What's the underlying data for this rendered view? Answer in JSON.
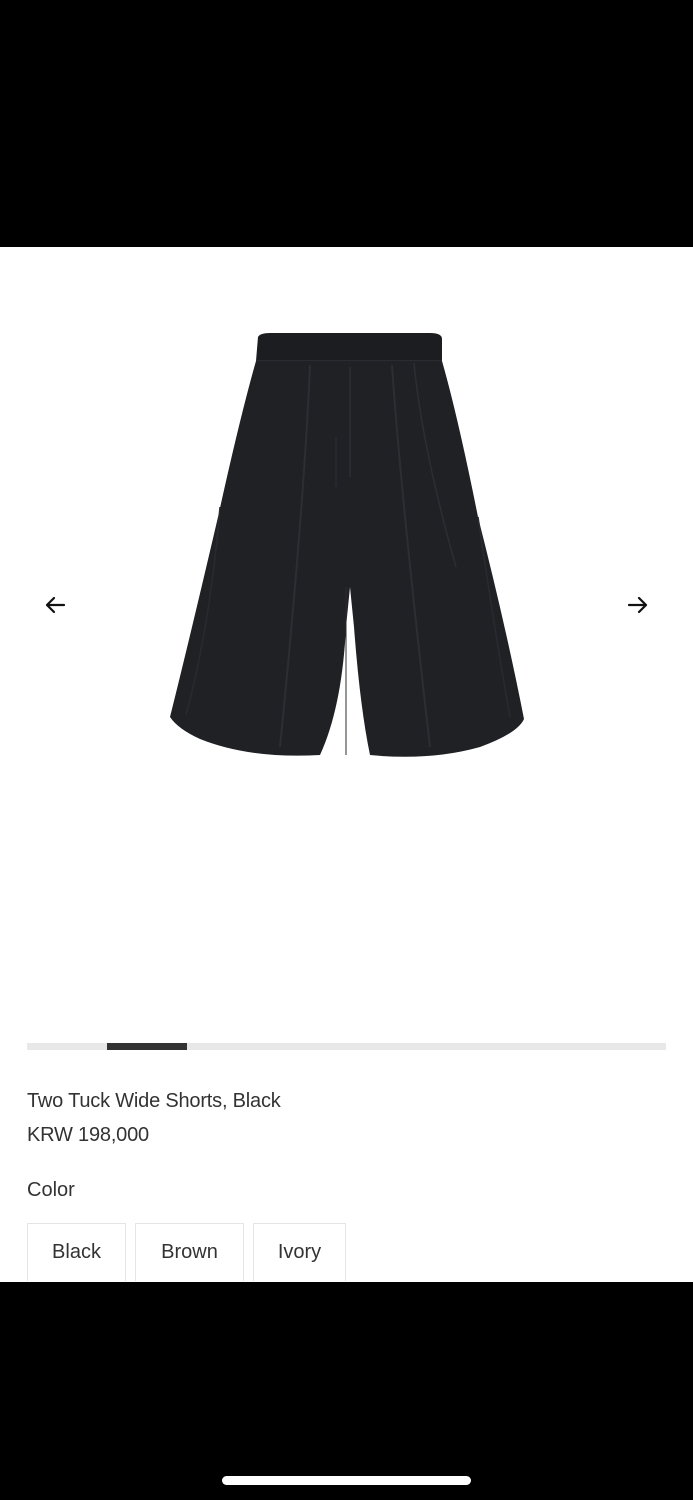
{
  "product": {
    "name": "Two Tuck Wide Shorts, Black",
    "price": "KRW 198,000",
    "image_icon": "shorts-product-image"
  },
  "gallery": {
    "prev_icon": "arrow-left-icon",
    "next_icon": "arrow-right-icon",
    "progress": {
      "current_slide_fraction_start": 0.125,
      "current_slide_fraction_end": 0.25
    }
  },
  "color_section": {
    "label": "Color",
    "options": [
      {
        "label": "Black"
      },
      {
        "label": "Brown"
      },
      {
        "label": "Ivory"
      }
    ]
  },
  "colors": {
    "background": "#ffffff",
    "text": "#333333",
    "progress_track": "#e8e8e8",
    "progress_fill": "#333333",
    "product": "#1f2125"
  }
}
